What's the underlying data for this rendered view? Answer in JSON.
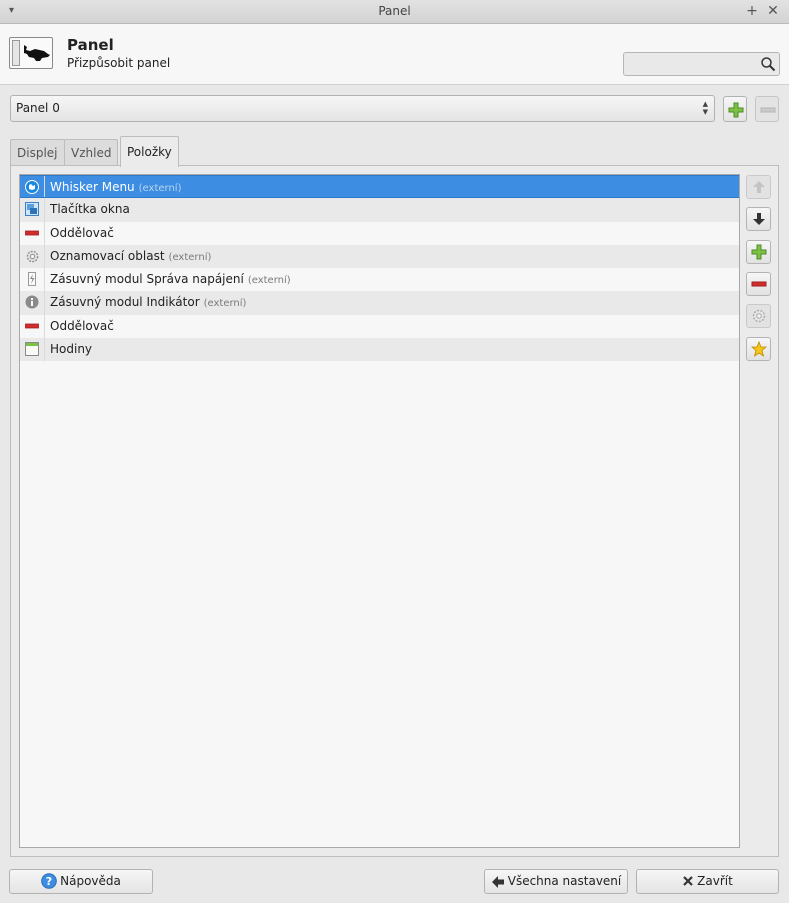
{
  "window": {
    "title": "Panel"
  },
  "header": {
    "title": "Panel",
    "subtitle": "Přizpůsobit panel"
  },
  "search": {
    "placeholder": "",
    "value": ""
  },
  "panel_select": {
    "value": "Panel 0"
  },
  "tabs": [
    {
      "label": "Displej",
      "active": false
    },
    {
      "label": "Vzhled",
      "active": false
    },
    {
      "label": "Položky",
      "active": true
    }
  ],
  "items": [
    {
      "label": "Whisker Menu",
      "external": "(externí)",
      "icon": "whisker-menu-icon",
      "selected": true
    },
    {
      "label": "Tlačítka okna",
      "external": "",
      "icon": "window-buttons-icon",
      "selected": false
    },
    {
      "label": "Oddělovač",
      "external": "",
      "icon": "separator-icon",
      "selected": false
    },
    {
      "label": "Oznamovací oblast",
      "external": "(externí)",
      "icon": "gear-icon",
      "selected": false
    },
    {
      "label": "Zásuvný modul Správa napájení",
      "external": "(externí)",
      "icon": "power-manager-icon",
      "selected": false
    },
    {
      "label": "Zásuvný modul Indikátor",
      "external": "(externí)",
      "icon": "indicator-icon",
      "selected": false
    },
    {
      "label": "Oddělovač",
      "external": "",
      "icon": "separator-icon",
      "selected": false
    },
    {
      "label": "Hodiny",
      "external": "",
      "icon": "clock-icon",
      "selected": false
    }
  ],
  "side_buttons": [
    {
      "name": "move-up-button",
      "icon": "arrow-up-icon",
      "enabled": false
    },
    {
      "name": "move-down-button",
      "icon": "arrow-down-icon",
      "enabled": true
    },
    {
      "name": "add-item-button",
      "icon": "plus-icon",
      "enabled": true
    },
    {
      "name": "remove-item-button",
      "icon": "minus-icon",
      "enabled": true
    },
    {
      "name": "item-properties-button",
      "icon": "gear-icon",
      "enabled": false
    },
    {
      "name": "item-about-button",
      "icon": "star-icon",
      "enabled": true
    }
  ],
  "footer": {
    "help_label": "Nápověda",
    "all_settings_label": "Všechna nastavení",
    "close_label": "Zavřít"
  },
  "colors": {
    "selection": "#3d8ee2",
    "add_green": "#6db33f",
    "remove_red": "#d42b2b"
  }
}
